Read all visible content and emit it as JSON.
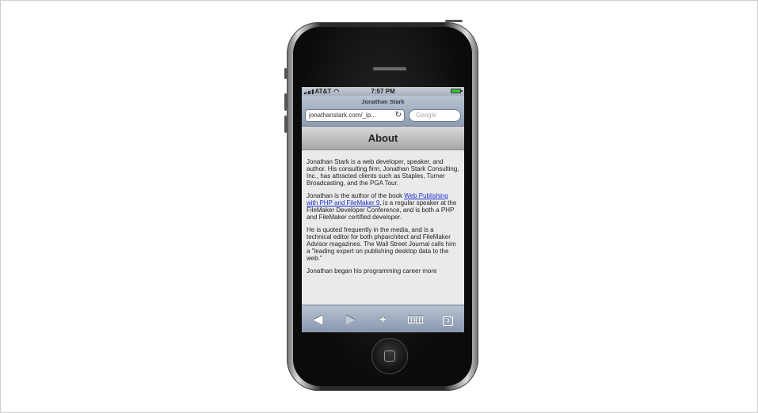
{
  "statusbar": {
    "carrier": "AT&T",
    "time": "7:57 PM",
    "battery_level": 1.0
  },
  "browser": {
    "page_title": "Jonathan Stark",
    "address": "jonathanstark.com/_ip...",
    "search_placeholder": "Google"
  },
  "page": {
    "header": "About",
    "para1": "Jonathan Stark is a web developer, speaker, and author. His consulting firm, Jonathan Stark Consulting, Inc., has attracted clients such as Staples, Turner Broadcasting, and the PGA Tour.",
    "para2_before": "Jonathan is the author of the book ",
    "para2_link": "Web Publishing with PHP and FileMaker 9",
    "para2_after": ", is a regular speaker at the FileMaker Developer Conference, and is both a PHP and FileMaker certified developer.",
    "para3": "He is quoted frequently in the media, and is a technical editor for both phparchitect and FileMaker Advisor magazines. The Wall Street Journal calls him a \"leading expert on publishing desktop data to the web.\"",
    "para4": "Jonathan began his programming career more"
  },
  "toolbar": {
    "back": "◀",
    "forward": "▶",
    "add": "+",
    "bookmarks": "📖",
    "pages_count": "3"
  },
  "icons": [
    "signal-icon",
    "wifi-icon",
    "battery-icon",
    "reload-icon",
    "back-icon",
    "forward-icon",
    "add-icon",
    "bookmarks-icon",
    "pages-icon",
    "home-button-icon"
  ]
}
